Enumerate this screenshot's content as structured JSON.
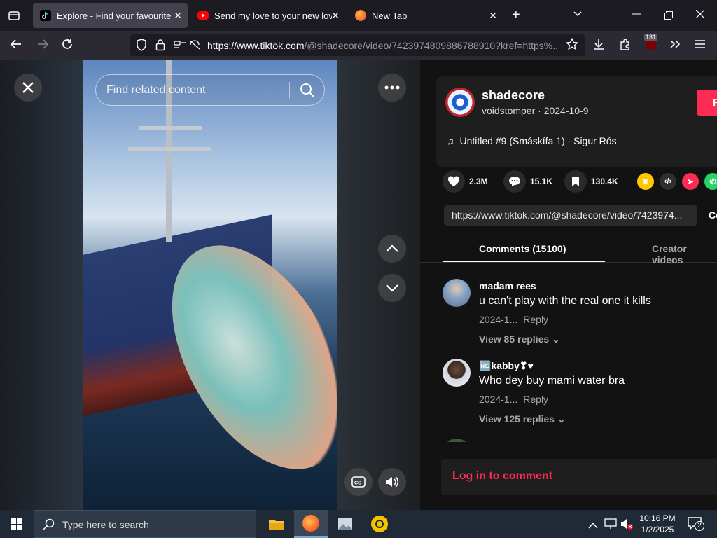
{
  "browser": {
    "tabs": [
      {
        "title": "Explore - Find your favourite vi",
        "active": true
      },
      {
        "title": "Send my love to your new love",
        "active": false
      },
      {
        "title": "New Tab",
        "active": false
      }
    ],
    "url_main": "https://www.tiktok.com",
    "url_path": "/@shadecore/video/7423974809886788910?kref=https%...",
    "extension_badge": "131"
  },
  "video_panel": {
    "search_placeholder": "Find related content",
    "icons": [
      "close-icon",
      "more-icon",
      "chevron-up-icon",
      "chevron-down-icon",
      "captions-icon",
      "volume-icon"
    ]
  },
  "post": {
    "username": "shadecore",
    "meta": "voidstomper · 2024-10-9",
    "music": "Untitled #9 (Smáskífa 1) - Sigur Rós",
    "likes": "2.3M",
    "comments_count": "15.1K",
    "saves": "130.4K",
    "link": "https://www.tiktok.com/@shadecore/video/7423974...",
    "copy_label": "Co",
    "follow_label": "F"
  },
  "tabs": {
    "comments": "Comments (15100)",
    "creator": "Creator videos"
  },
  "comments": [
    {
      "user": "madam rees",
      "text": "u can't play with the real one it kills",
      "date": "2024-1...",
      "reply": "Reply",
      "view": "View 85 replies"
    },
    {
      "user": "🆖kabby❣♥",
      "text": "Who dey buy mami water bra",
      "date": "2024-1...",
      "reply": "Reply",
      "view": "View 125 replies"
    }
  ],
  "login": "Log in to comment",
  "taskbar": {
    "search_placeholder": "Type here to search",
    "time": "10:16 PM",
    "date": "1/2/2025",
    "notifications": "2"
  },
  "colors": {
    "accent": "#fe2c55",
    "background": "#121212"
  }
}
